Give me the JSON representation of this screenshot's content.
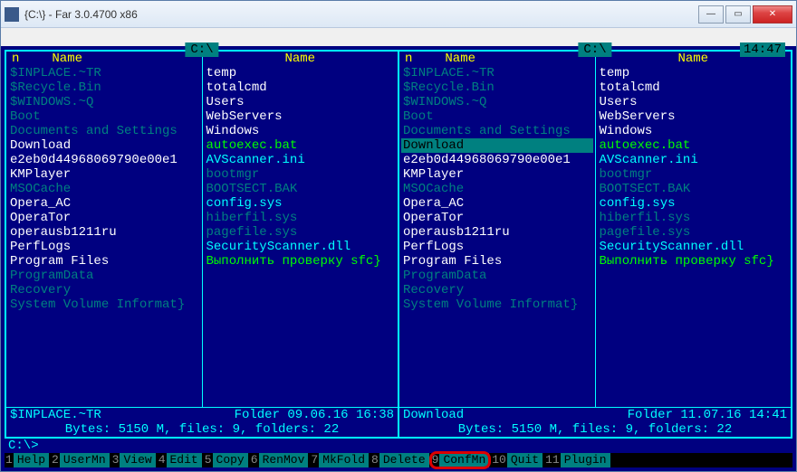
{
  "window": {
    "title": "{C:\\} - Far 3.0.4700 x86"
  },
  "clock": "14:47",
  "left": {
    "path": " C:\\ ",
    "headers": {
      "n": "n",
      "name": "Name",
      "name2": "Name"
    },
    "col1": [
      {
        "t": "$INPLACE.~TR",
        "c": "c-dim"
      },
      {
        "t": "$Recycle.Bin",
        "c": "c-dim"
      },
      {
        "t": "$WINDOWS.~Q",
        "c": "c-dim"
      },
      {
        "t": "Boot",
        "c": "c-dim"
      },
      {
        "t": "Documents and Settings",
        "c": "c-dim"
      },
      {
        "t": "Download",
        "c": "c-dir"
      },
      {
        "t": "e2eb0d44968069790e00e1",
        "c": "c-dir"
      },
      {
        "t": "KMPlayer",
        "c": "c-dir"
      },
      {
        "t": "MSOCache",
        "c": "c-dim"
      },
      {
        "t": "Opera_AC",
        "c": "c-dir"
      },
      {
        "t": "OperaTor",
        "c": "c-dir"
      },
      {
        "t": "operausb1211ru",
        "c": "c-dir"
      },
      {
        "t": "PerfLogs",
        "c": "c-dir"
      },
      {
        "t": "Program Files",
        "c": "c-dir"
      },
      {
        "t": "ProgramData",
        "c": "c-dim"
      },
      {
        "t": "Recovery",
        "c": "c-dim"
      },
      {
        "t": "System Volume Informat}",
        "c": "c-dim"
      }
    ],
    "col2": [
      {
        "t": "temp",
        "c": "c-dir"
      },
      {
        "t": "totalcmd",
        "c": "c-dir"
      },
      {
        "t": "Users",
        "c": "c-dir"
      },
      {
        "t": "WebServers",
        "c": "c-dir"
      },
      {
        "t": "Windows",
        "c": "c-dir"
      },
      {
        "t": "autoexec.bat",
        "c": "c-exec"
      },
      {
        "t": "AVScanner.ini",
        "c": ""
      },
      {
        "t": "bootmgr",
        "c": "c-dim"
      },
      {
        "t": "BOOTSECT.BAK",
        "c": "c-dim"
      },
      {
        "t": "config.sys",
        "c": ""
      },
      {
        "t": "hiberfil.sys",
        "c": "c-dim"
      },
      {
        "t": "pagefile.sys",
        "c": "c-dim"
      },
      {
        "t": "SecurityScanner.dll",
        "c": ""
      },
      {
        "t": "Выполнить проверку sfc}",
        "c": "c-exec"
      }
    ],
    "footer_left": "$INPLACE.~TR",
    "footer_right": "Folder 09.06.16 16:38",
    "stats": "Bytes: 5150 M, files: 9, folders: 22"
  },
  "right": {
    "path": " C:\\ ",
    "headers": {
      "n": "n",
      "name": "Name",
      "name2": "Name"
    },
    "col1": [
      {
        "t": "$INPLACE.~TR",
        "c": "c-dim"
      },
      {
        "t": "$Recycle.Bin",
        "c": "c-dim"
      },
      {
        "t": "$WINDOWS.~Q",
        "c": "c-dim"
      },
      {
        "t": "Boot",
        "c": "c-dim"
      },
      {
        "t": "Documents and Settings",
        "c": "c-dim"
      },
      {
        "t": "Download",
        "c": "c-dir",
        "sel": true
      },
      {
        "t": "e2eb0d44968069790e00e1",
        "c": "c-dir"
      },
      {
        "t": "KMPlayer",
        "c": "c-dir"
      },
      {
        "t": "MSOCache",
        "c": "c-dim"
      },
      {
        "t": "Opera_AC",
        "c": "c-dir"
      },
      {
        "t": "OperaTor",
        "c": "c-dir"
      },
      {
        "t": "operausb1211ru",
        "c": "c-dir"
      },
      {
        "t": "PerfLogs",
        "c": "c-dir"
      },
      {
        "t": "Program Files",
        "c": "c-dir"
      },
      {
        "t": "ProgramData",
        "c": "c-dim"
      },
      {
        "t": "Recovery",
        "c": "c-dim"
      },
      {
        "t": "System Volume Informat}",
        "c": "c-dim"
      }
    ],
    "col2": [
      {
        "t": "temp",
        "c": "c-dir"
      },
      {
        "t": "totalcmd",
        "c": "c-dir"
      },
      {
        "t": "Users",
        "c": "c-dir"
      },
      {
        "t": "WebServers",
        "c": "c-dir"
      },
      {
        "t": "Windows",
        "c": "c-dir"
      },
      {
        "t": "autoexec.bat",
        "c": "c-exec"
      },
      {
        "t": "AVScanner.ini",
        "c": ""
      },
      {
        "t": "bootmgr",
        "c": "c-dim"
      },
      {
        "t": "BOOTSECT.BAK",
        "c": "c-dim"
      },
      {
        "t": "config.sys",
        "c": ""
      },
      {
        "t": "hiberfil.sys",
        "c": "c-dim"
      },
      {
        "t": "pagefile.sys",
        "c": "c-dim"
      },
      {
        "t": "SecurityScanner.dll",
        "c": ""
      },
      {
        "t": "Выполнить проверку sfc}",
        "c": "c-exec"
      }
    ],
    "footer_left": "Download",
    "footer_right": "Folder 11.07.16 14:41",
    "stats": "Bytes: 5150 M, files: 9, folders: 22"
  },
  "cmdline": {
    "prompt": "C:\\>"
  },
  "keybar": [
    {
      "n": "1",
      "l": "Help"
    },
    {
      "n": "2",
      "l": "UserMn"
    },
    {
      "n": "3",
      "l": "View"
    },
    {
      "n": "4",
      "l": "Edit"
    },
    {
      "n": "5",
      "l": "Copy"
    },
    {
      "n": "6",
      "l": "RenMov"
    },
    {
      "n": "7",
      "l": "MkFold"
    },
    {
      "n": "8",
      "l": "Delete"
    },
    {
      "n": "9",
      "l": "ConfMn",
      "hl": true
    },
    {
      "n": "10",
      "l": "Quit"
    },
    {
      "n": "11",
      "l": "Plugin"
    }
  ]
}
